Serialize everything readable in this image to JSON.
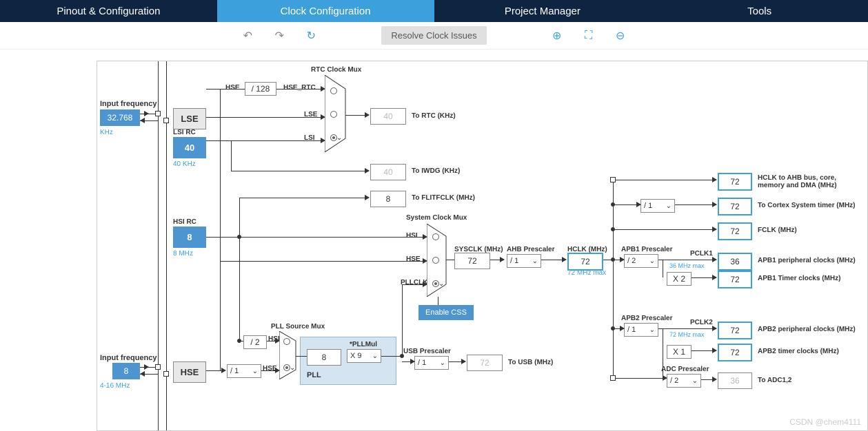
{
  "tabs": {
    "pinout": "Pinout & Configuration",
    "clock": "Clock Configuration",
    "project": "Project Manager",
    "tools": "Tools"
  },
  "toolbar": {
    "resolve": "Resolve Clock Issues"
  },
  "lse": {
    "label": "Input frequency",
    "val": "32.768",
    "unit": "KHz",
    "osc": "LSE"
  },
  "lsi": {
    "label": "LSI RC",
    "val": "40",
    "sub": "40 KHz"
  },
  "hsi": {
    "label": "HSI RC",
    "val": "8",
    "sub": "8 MHz"
  },
  "hse": {
    "label": "Input frequency",
    "val": "8",
    "unit": "4-16 MHz",
    "osc": "HSE",
    "div": "/ 1"
  },
  "rtc": {
    "title": "RTC Clock Mux",
    "hsediv": "/ 128",
    "l1": "HSE",
    "l2": "HSE_RTC",
    "l3": "LSE",
    "l4": "LSI",
    "out": "40",
    "outlbl": "To RTC (KHz)"
  },
  "iwdg": {
    "val": "40",
    "lbl": "To IWDG (KHz)"
  },
  "flitf": {
    "val": "8",
    "lbl": "To FLITFCLK (MHz)"
  },
  "pll": {
    "title": "PLL Source Mux",
    "hsidiv": "/ 2",
    "l1": "HSI",
    "l2": "HSE",
    "area": "PLL",
    "val": "8",
    "mul": "X 9",
    "mullbl": "*PLLMul"
  },
  "sysmux": {
    "title": "System Clock Mux",
    "l1": "HSI",
    "l2": "HSE",
    "l3": "PLLCLK",
    "css": "Enable CSS"
  },
  "sysclk": {
    "lbl": "SYSCLK (MHz)",
    "val": "72"
  },
  "ahb": {
    "lbl": "AHB Prescaler",
    "val": "/ 1"
  },
  "hclk": {
    "lbl": "HCLK (MHz)",
    "val": "72",
    "sub": "72 MHz max"
  },
  "usb": {
    "title": "USB Prescaler",
    "val": "/ 1",
    "out": "72",
    "outlbl": "To USB (MHz)"
  },
  "apb1": {
    "title": "APB1 Prescaler",
    "val": "/ 2",
    "sub": "36 MHz max",
    "lbl": "PCLK1"
  },
  "apb2": {
    "title": "APB2 Prescaler",
    "val": "/ 1",
    "sub": "72 MHz max",
    "lbl": "PCLK2"
  },
  "cortex": {
    "val": "/ 1"
  },
  "mult": {
    "apb1": "X 2",
    "apb2": "X 1",
    "adc": "/ 2"
  },
  "outputs": {
    "hclk_ahb": {
      "val": "72",
      "lbl": "HCLK to AHB bus, core, memory and DMA (MHz)"
    },
    "cortex": {
      "val": "72",
      "lbl": "To Cortex System timer (MHz)"
    },
    "fclk": {
      "val": "72",
      "lbl": "FCLK (MHz)"
    },
    "pclk1": {
      "val": "36",
      "lbl": "APB1 peripheral clocks (MHz)"
    },
    "apb1tim": {
      "val": "72",
      "lbl": "APB1 Timer clocks (MHz)"
    },
    "pclk2": {
      "val": "72",
      "lbl": "APB2 peripheral clocks (MHz)"
    },
    "apb2tim": {
      "val": "72",
      "lbl": "APB2 timer clocks (MHz)"
    },
    "adc": {
      "val": "36",
      "lbl": "To ADC1,2",
      "title": "ADC Prescaler"
    }
  },
  "watermark": "CSDN @chem4111"
}
